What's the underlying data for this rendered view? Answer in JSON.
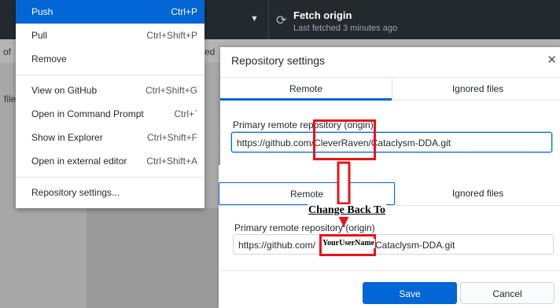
{
  "toolbar": {
    "fetch_title": "Fetch origin",
    "fetch_subtitle": "Last fetched 3 minutes ago"
  },
  "background": {
    "left_text": "of",
    "mid_text": "ed",
    "side_label": "file"
  },
  "menu": {
    "items": [
      {
        "label": "Push",
        "shortcut": "Ctrl+P"
      },
      {
        "label": "Pull",
        "shortcut": "Ctrl+Shift+P"
      },
      {
        "label": "Remove",
        "shortcut": ""
      },
      {
        "label": "View on GitHub",
        "shortcut": "Ctrl+Shift+G"
      },
      {
        "label": "Open in Command Prompt",
        "shortcut": "Ctrl+`"
      },
      {
        "label": "Show in Explorer",
        "shortcut": "Ctrl+Shift+F"
      },
      {
        "label": "Open in external editor",
        "shortcut": "Ctrl+Shift+A"
      },
      {
        "label": "Repository settings...",
        "shortcut": ""
      }
    ]
  },
  "dialog": {
    "title": "Repository settings",
    "tabs": [
      "Remote",
      "Ignored files"
    ],
    "field_label": "Primary remote repository (origin)",
    "original_value": "https://github.com/CleverRaven/Cataclysm-DDA.git",
    "new_value_prefix": "https://github.com/",
    "new_value_suffix": "Cataclysm-DDA.git",
    "save_label": "Save",
    "cancel_label": "Cancel"
  },
  "annotation": {
    "label": "Change Back To",
    "username": "YourUserName"
  },
  "colors": {
    "accent": "#0366d6",
    "annotation_red": "#e8141b",
    "toolbar": "#24292e"
  }
}
